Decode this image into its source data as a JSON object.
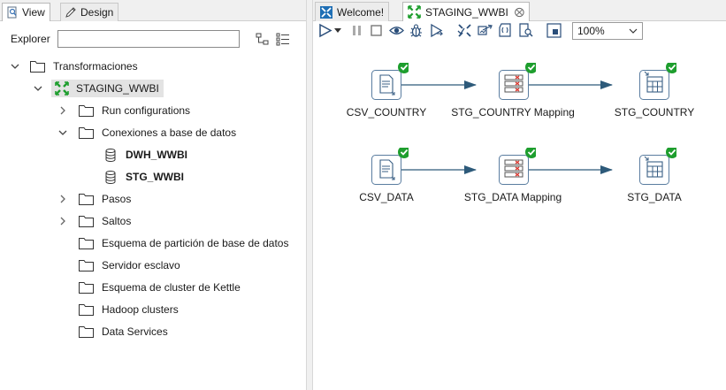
{
  "left_panel": {
    "tabs": [
      {
        "label": "View",
        "icon": "view-icon",
        "active": true
      },
      {
        "label": "Design",
        "icon": "pencil-icon",
        "active": false
      }
    ],
    "explorer": {
      "label": "Explorer",
      "input_value": "",
      "placeholder": ""
    },
    "tree": {
      "root": "Transformaciones",
      "transformation": "STAGING_WWBI",
      "children": {
        "run_configurations": "Run configurations",
        "conexiones": "Conexiones a base de datos",
        "connections": [
          "DWH_WWBI",
          "STG_WWBI"
        ],
        "pasos": "Pasos",
        "saltos": "Saltos",
        "esquema_particion": "Esquema de partición de base de datos",
        "servidor_esclavo": "Servidor esclavo",
        "esquema_cluster": "Esquema de cluster de Kettle",
        "hadoop_clusters": "Hadoop clusters",
        "data_services": "Data Services"
      }
    }
  },
  "right_panel": {
    "tabs": [
      {
        "label": "Welcome!",
        "icon": "spoon-icon",
        "active": false
      },
      {
        "label": "STAGING_WWBI",
        "icon": "transformation-icon",
        "active": true,
        "closable": true
      }
    ],
    "toolbar": {
      "zoom": "100%",
      "zoom_options": [
        "100%"
      ]
    },
    "canvas": {
      "steps_row1": [
        "CSV_COUNTRY",
        "STG_COUNTRY Mapping",
        "STG_COUNTRY"
      ],
      "steps_row2": [
        "CSV_DATA",
        "STG_DATA Mapping",
        "STG_DATA"
      ]
    }
  },
  "colors": {
    "accent_green": "#1e9e2e",
    "hop_line": "#2d5a7a",
    "step_border": "#5a7da0",
    "selected_bg": "#e3e3e3"
  }
}
